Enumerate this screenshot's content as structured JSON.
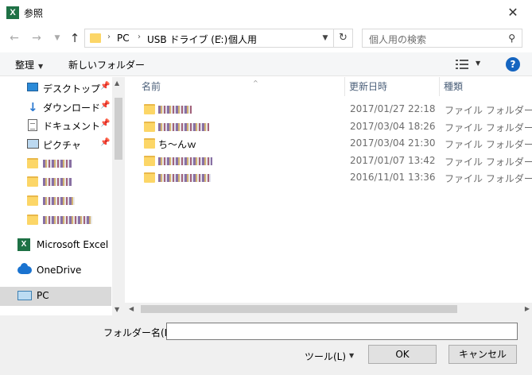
{
  "window": {
    "title": "参照",
    "app_icon": "excel-icon",
    "close_glyph": "✕"
  },
  "address_bar": {
    "crumbs": [
      "PC",
      "USB ドライブ (E:)",
      "個人用"
    ]
  },
  "search": {
    "placeholder": "個人用の検索"
  },
  "toolbar": {
    "organize": "整理",
    "new_folder": "新しいフォルダー"
  },
  "nav_pane": {
    "quick_access": [
      {
        "label": "デスクトップ",
        "icon": "desktop-icon",
        "pinned": true
      },
      {
        "label": "ダウンロード",
        "icon": "download-icon",
        "pinned": true
      },
      {
        "label": "ドキュメント",
        "icon": "document-icon",
        "pinned": true
      },
      {
        "label": "ピクチャ",
        "icon": "picture-icon",
        "pinned": true
      }
    ],
    "top_level": [
      {
        "label": "Microsoft Excel",
        "icon": "excel-icon"
      },
      {
        "label": "OneDrive",
        "icon": "onedrive-icon"
      },
      {
        "label": "PC",
        "icon": "pc-icon",
        "selected": true
      }
    ]
  },
  "file_list": {
    "columns": [
      "名前",
      "更新日時",
      "種類"
    ],
    "rows": [
      {
        "name": "",
        "date": "2017/01/27 22:18",
        "type": "ファイル フォルダー"
      },
      {
        "name": "",
        "date": "2017/03/04 18:26",
        "type": "ファイル フォルダー"
      },
      {
        "name": "ち～んｗ",
        "date": "2017/03/04 21:30",
        "type": "ファイル フォルダー"
      },
      {
        "name": "",
        "date": "2017/01/07 13:42",
        "type": "ファイル フォルダー"
      },
      {
        "name": "",
        "date": "2016/11/01 13:36",
        "type": "ファイル フォルダー"
      }
    ]
  },
  "footer": {
    "filename_label": "フォルダー名(N):",
    "filename_value": "",
    "tools_label": "ツール(L)",
    "ok_label": "OK",
    "cancel_label": "キャンセル"
  },
  "colors": {
    "folder": "#fcd667",
    "selection": "#d9d9d9",
    "help": "#1565c0",
    "excel": "#1e7145"
  }
}
